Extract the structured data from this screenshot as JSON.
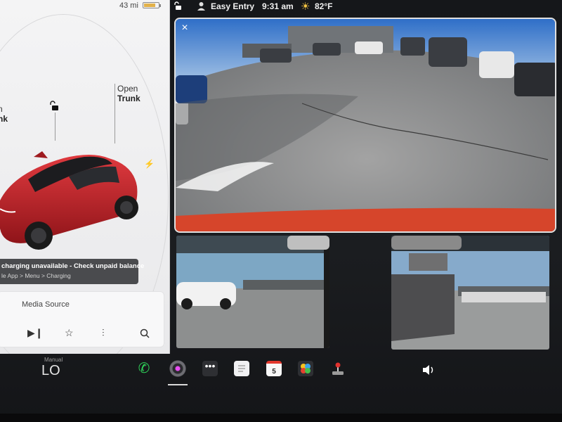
{
  "colors": {
    "car_red": "#c9262c",
    "alert_bg": "#4a4b4e",
    "phone_green": "#2fd159",
    "sun_yellow": "#f5c542",
    "screen_bg": "#1b1d20"
  },
  "car_panel": {
    "range": "43 mi",
    "frunk_label_line1": "n",
    "frunk_label_line2": "nk",
    "trunk_label_line1": "Open",
    "trunk_label_line2": "Trunk",
    "icons": [
      "lock-icon",
      "charge-port-icon"
    ],
    "alert": {
      "title": "charging unavailable - Check unpaid balance",
      "subtitle": "le App > Menu > Charging"
    }
  },
  "media": {
    "source_label": "Media Source",
    "controls": [
      "next-track-icon",
      "favorite-star-icon",
      "equalizer-icon",
      "search-icon"
    ]
  },
  "status_bar": {
    "profile": "Easy Entry",
    "time": "9:31 am",
    "temperature": "82°F",
    "icons": [
      "lock-icon",
      "user-icon",
      "sun-icon"
    ]
  },
  "camera": {
    "close_glyph": "×",
    "views": [
      "rear-camera",
      "left-repeater-camera",
      "right-repeater-camera"
    ]
  },
  "dock": {
    "climate_label": "Manual",
    "climate_temp": "LO",
    "calendar_day": "5",
    "more_glyph": "•••",
    "apps": [
      "phone-icon",
      "camera-icon",
      "more-icon",
      "notes-icon",
      "calendar-icon",
      "arcade-icon",
      "joystick-icon",
      "volume-icon"
    ]
  }
}
